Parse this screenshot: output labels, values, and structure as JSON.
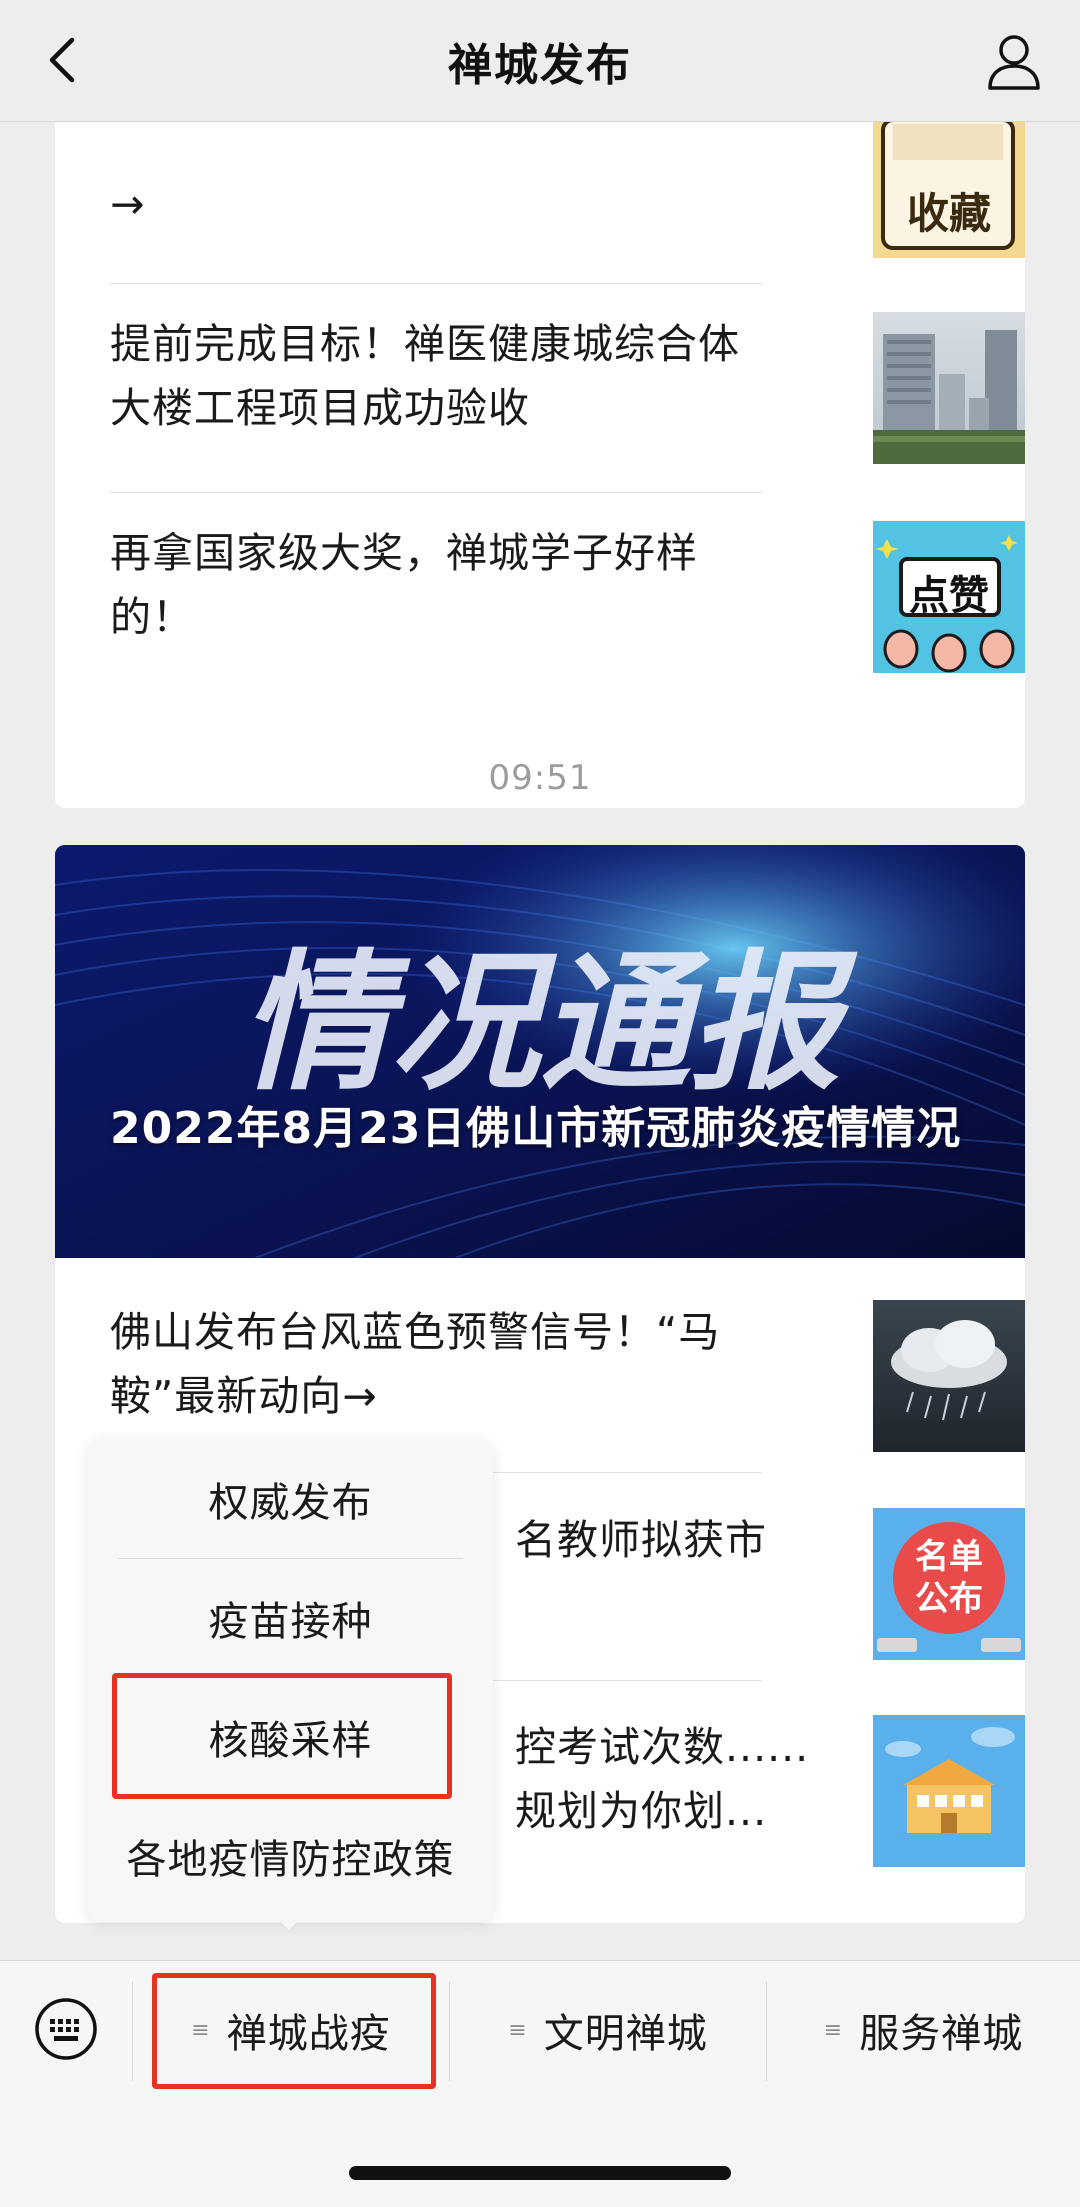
{
  "header": {
    "title": "禅城发布"
  },
  "timestamp": "09:51",
  "card1": {
    "items": [
      {
        "text": "→",
        "thumb_text": [
          "收藏"
        ]
      },
      {
        "text": "提前完成目标！禅医健康城综合体大楼工程项目成功验收"
      },
      {
        "text": "再拿国家级大奖，禅城学子好样的！",
        "thumb_text": [
          "点赞"
        ]
      }
    ]
  },
  "card2": {
    "banner_big_text": "情况通报",
    "banner_title": "2022年8月23日佛山市新冠肺炎疫情情况",
    "items": [
      {
        "text": "佛山发布台风蓝色预警信号！“马鞍”最新动向→"
      },
      {
        "text": "名教师拟获市",
        "thumb_text": [
          "名单",
          "公布"
        ]
      },
      {
        "text": "控考试次数......\n规划为你划..."
      }
    ]
  },
  "popup_menu": {
    "items": [
      "权威发布",
      "疫苗接种",
      "核酸采样",
      "各地疫情防控政策"
    ]
  },
  "bottom_tabs": [
    {
      "label": "禅城战疫"
    },
    {
      "label": "文明禅城"
    },
    {
      "label": "服务禅城"
    }
  ],
  "colors": {
    "highlight": "#e53222",
    "banner_bg": "#0a1450",
    "background": "#ededed"
  },
  "icons": [
    "back-chevron-icon",
    "profile-icon",
    "keyboard-icon",
    "menu-lines-icon"
  ]
}
